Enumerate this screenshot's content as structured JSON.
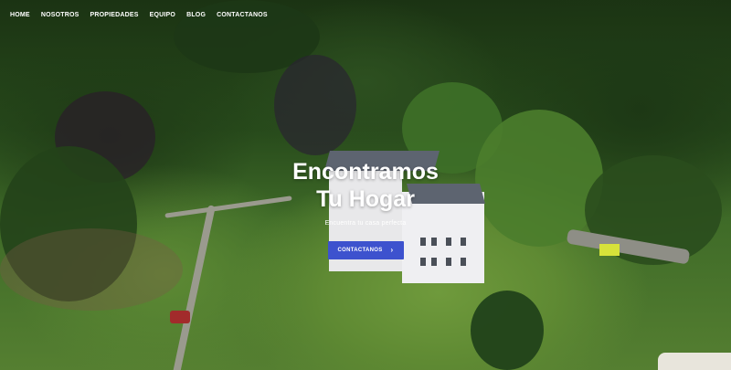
{
  "nav": {
    "items": [
      {
        "label": "HOME"
      },
      {
        "label": "NOSOTROS"
      },
      {
        "label": "PROPIEDADES"
      },
      {
        "label": "EQUIPO"
      },
      {
        "label": "BLOG"
      },
      {
        "label": "CONTACTANOS"
      }
    ]
  },
  "hero": {
    "title_line1": "Encontramos",
    "title_line2": "Tu Hogar",
    "subtitle": "Encuentra tu casa perfecta",
    "cta_label": "CONTACTANOS",
    "cta_icon": "chevron-right-icon"
  },
  "colors": {
    "cta_background": "#3d52ce",
    "text": "#ffffff"
  }
}
